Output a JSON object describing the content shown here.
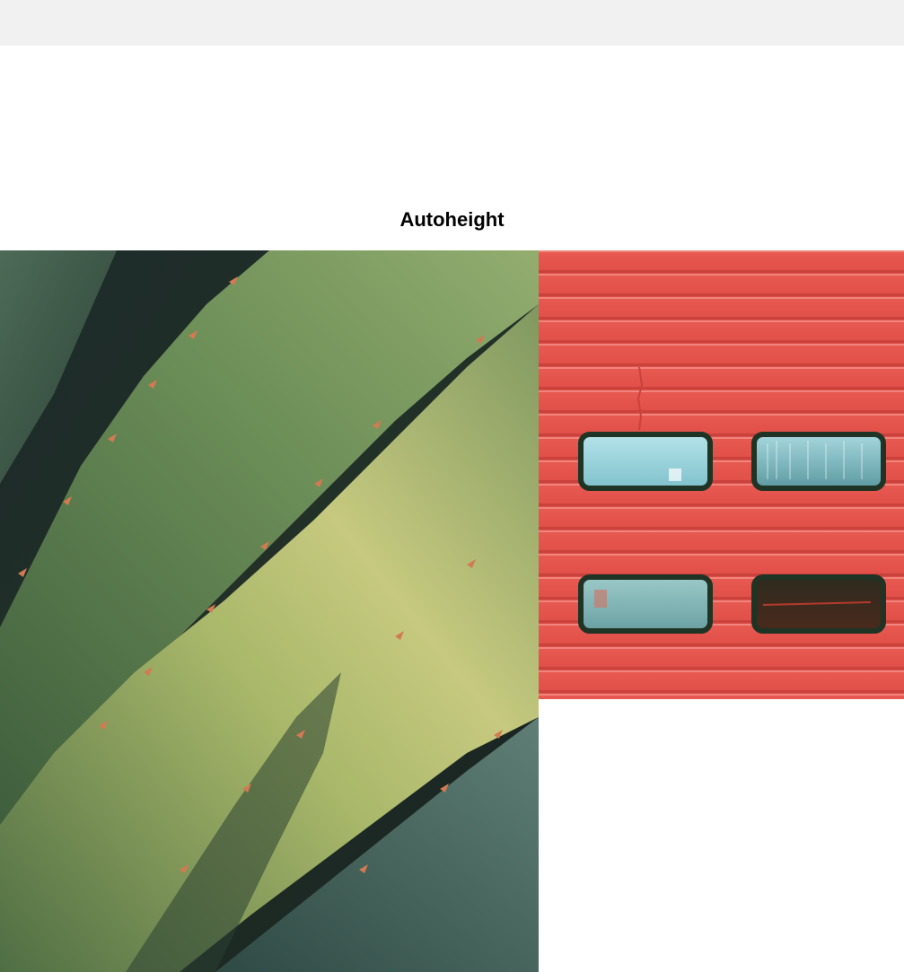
{
  "header": {
    "title": "Autoheight"
  },
  "slides": [
    {
      "name": "agave-leaves-photo"
    },
    {
      "name": "red-garage-door-photo"
    }
  ]
}
